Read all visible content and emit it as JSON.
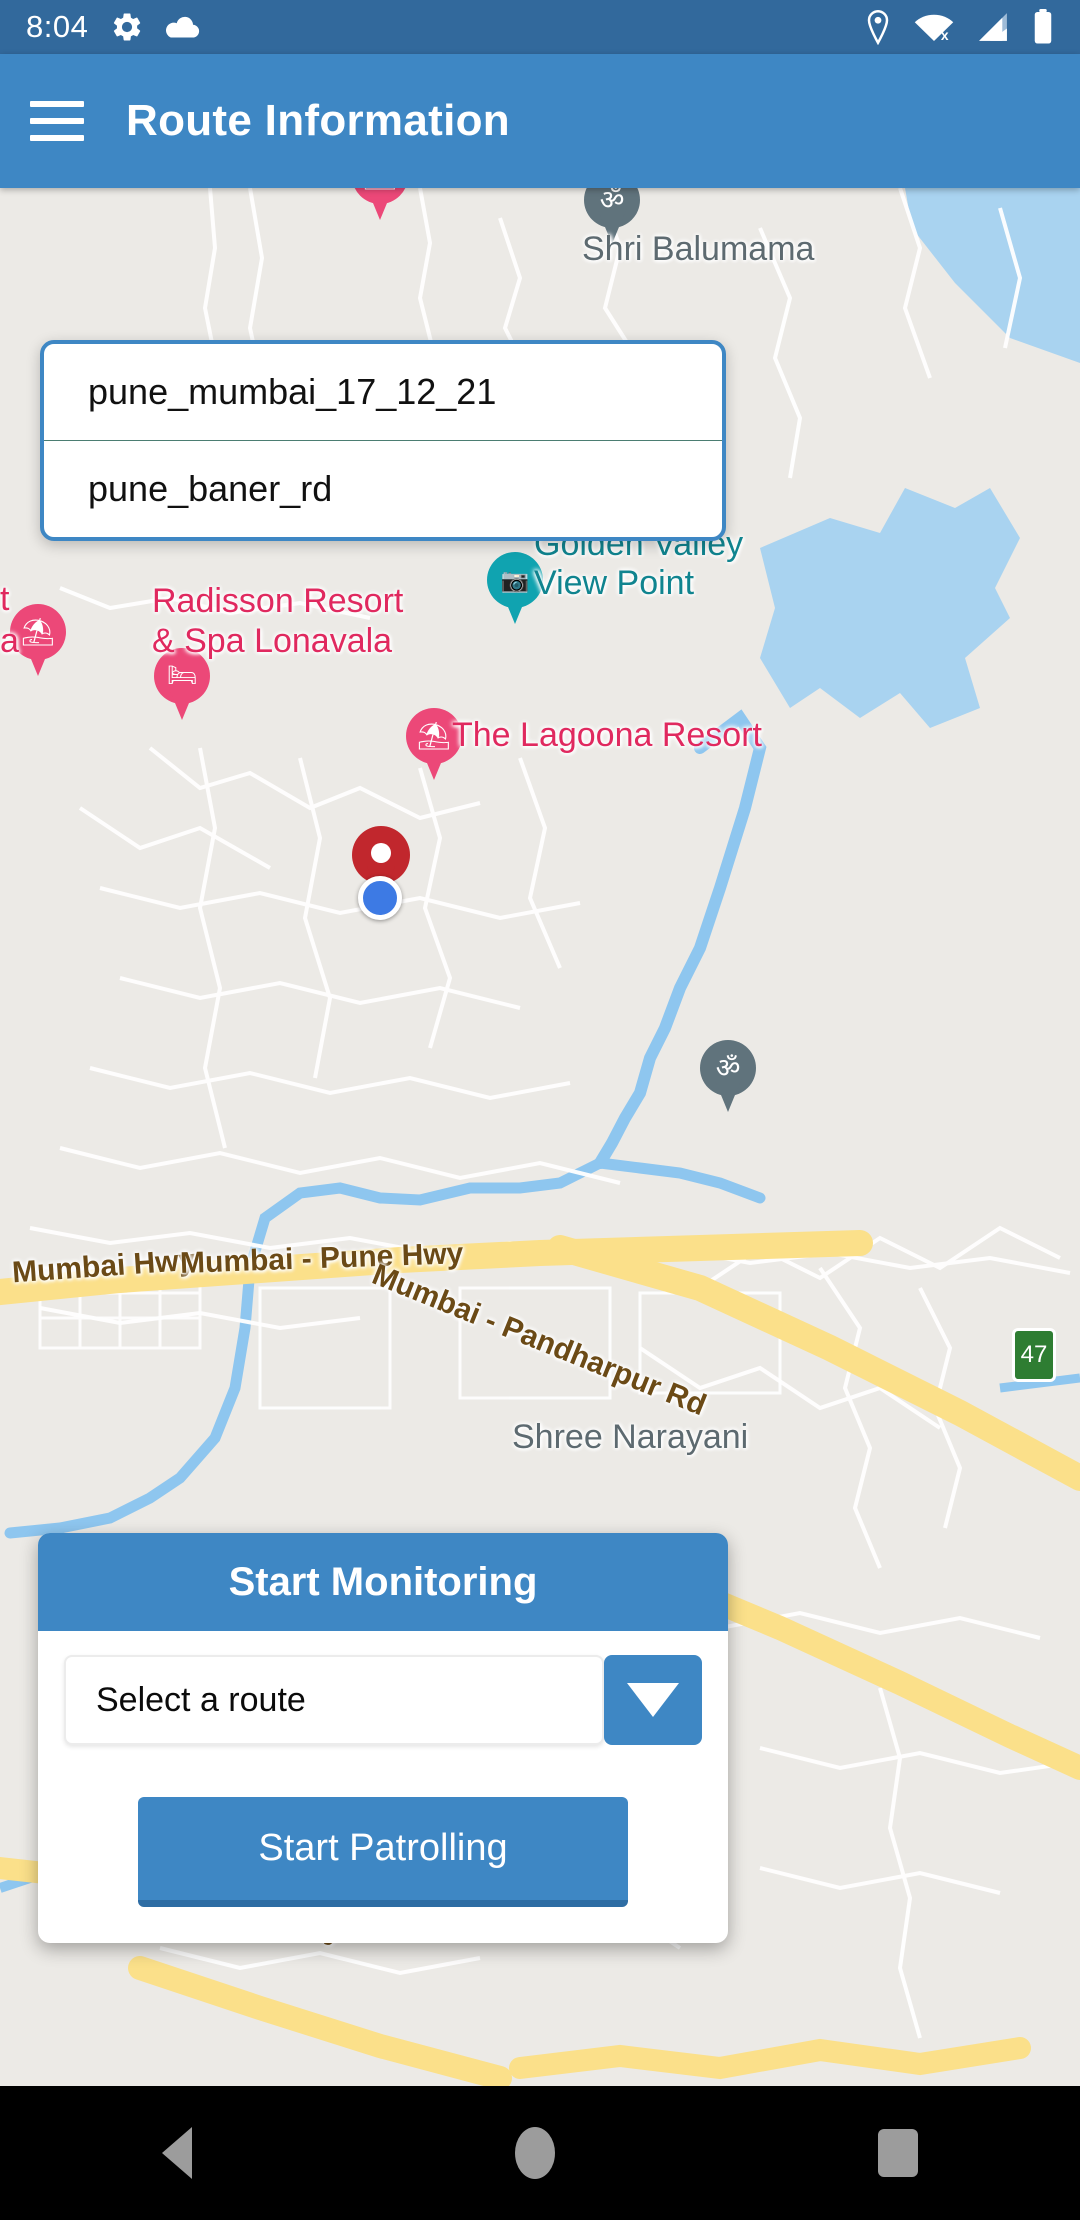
{
  "statusbar": {
    "time": "8:04",
    "icons_left": [
      "gear-icon",
      "cloud-icon"
    ],
    "icons_right": [
      "location-icon",
      "wifi-off-icon",
      "signal-icon",
      "battery-icon"
    ]
  },
  "appbar": {
    "menu_icon": "hamburger-menu-icon",
    "title": "Route Information"
  },
  "dropdown": {
    "items": [
      {
        "label": "pune_mumbai_17_12_21"
      },
      {
        "label": "pune_baner_rd"
      }
    ]
  },
  "card": {
    "title": "Start Monitoring",
    "select": {
      "value": "Select a route",
      "arrow_icon": "chevron-down-icon"
    },
    "primary_button": "Start Patrolling"
  },
  "map": {
    "labels": [
      {
        "text": "Shri Balumama",
        "kind": "grey"
      },
      {
        "text": "Radisson Resort",
        "kind": "pink"
      },
      {
        "text": "& Spa Lonavala",
        "kind": "pink"
      },
      {
        "text": "Golden Valley",
        "kind": "teal"
      },
      {
        "text": "View Point",
        "kind": "teal"
      },
      {
        "text": "The Lagoona Resort",
        "kind": "pink"
      },
      {
        "text": "Shree Narayani",
        "kind": "grey"
      },
      {
        "text": "Mumbai Hwy",
        "kind": "road"
      },
      {
        "text": "Mumbai - Pune Hwy",
        "kind": "road"
      },
      {
        "text": "Mumbai - Pandharpur Rd",
        "kind": "road"
      },
      {
        "text": "i - Pune Hwy",
        "kind": "road"
      },
      {
        "text": "t",
        "kind": "pink"
      },
      {
        "text": "a",
        "kind": "pink"
      },
      {
        "text": "47",
        "kind": "shield"
      }
    ],
    "markers": [
      {
        "name": "resort-pin",
        "glyph": "⛱"
      },
      {
        "name": "temple-pin",
        "glyph": "ॐ"
      },
      {
        "name": "hotel-pin",
        "glyph": "🛏"
      },
      {
        "name": "viewpoint-pin",
        "glyph": "📷"
      },
      {
        "name": "destination-pin",
        "glyph": ""
      },
      {
        "name": "current-location-dot",
        "glyph": ""
      }
    ]
  },
  "navbar": {
    "back": "back-button",
    "home": "home-button",
    "recents": "recents-button"
  },
  "colors": {
    "status_bar": "#32699c",
    "app_bar": "#3e87c4",
    "accent": "#3e87c4",
    "map_bg": "#eceae6",
    "poi_pink": "#e0295f",
    "poi_teal": "#10848f",
    "road_yellow": "#fbe08a",
    "water": "#a9d3f0"
  }
}
